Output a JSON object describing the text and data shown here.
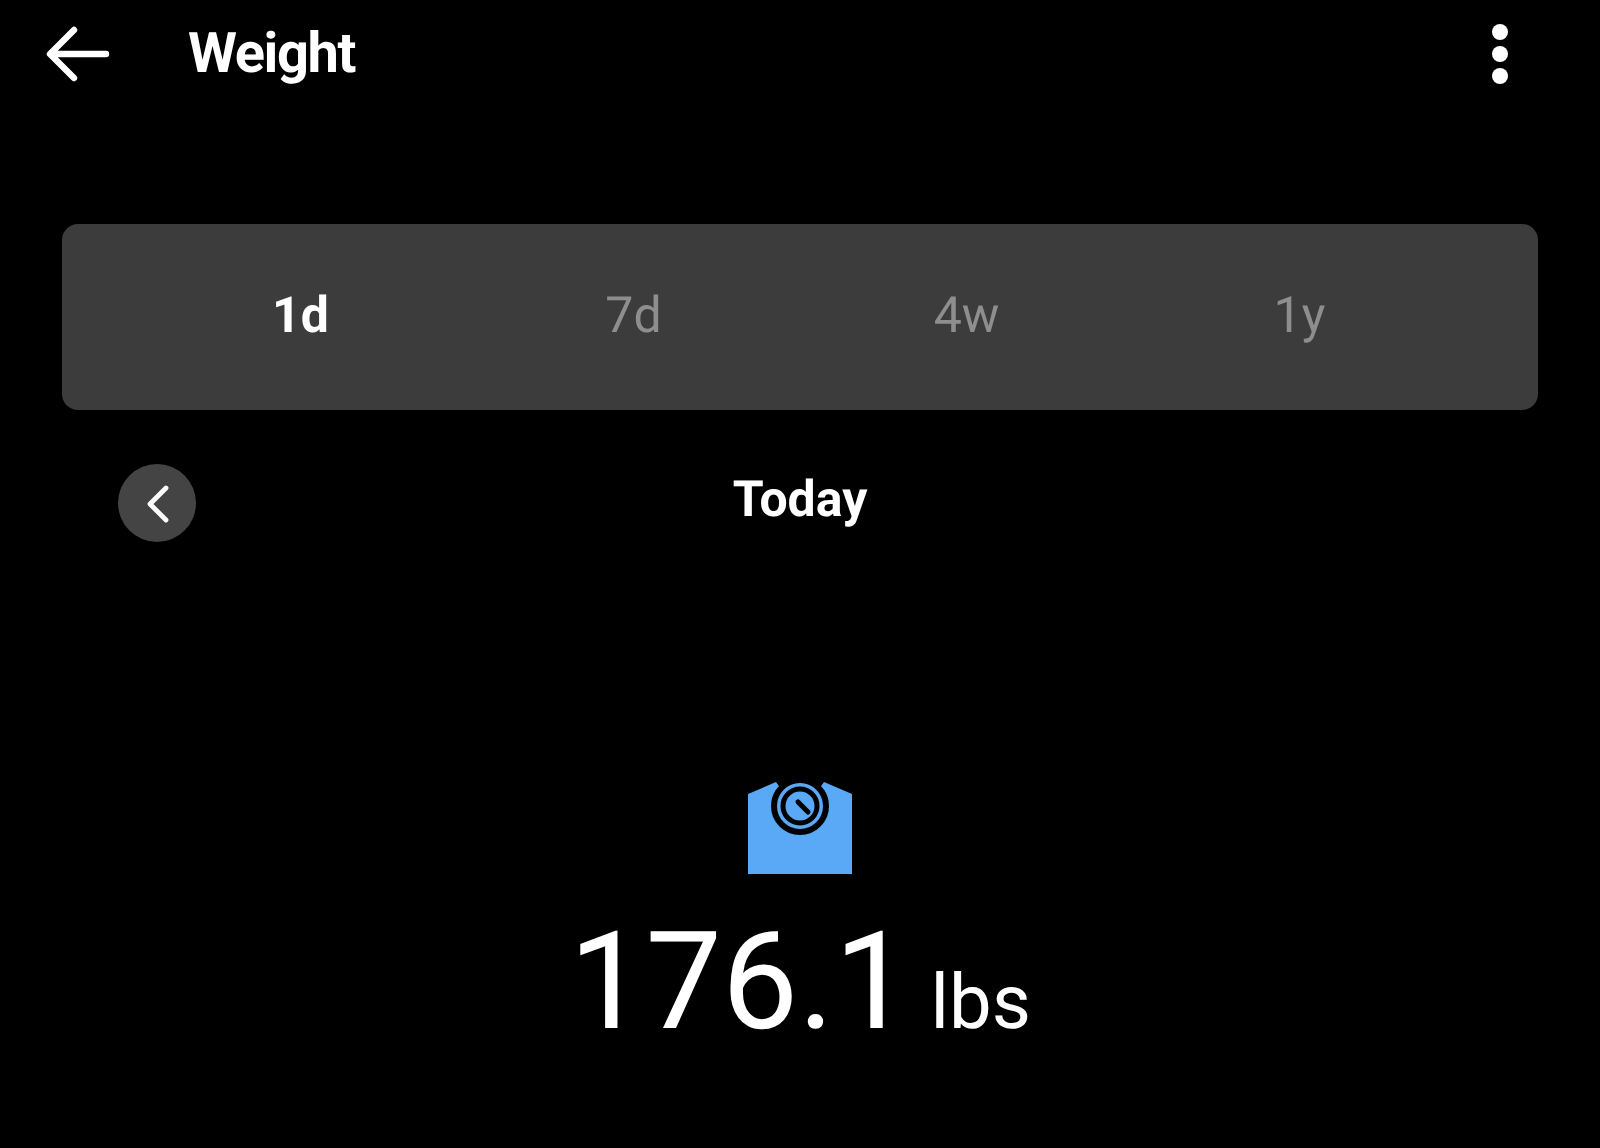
{
  "header": {
    "title": "Weight"
  },
  "tabs": [
    {
      "label": "1d",
      "selected": true
    },
    {
      "label": "7d",
      "selected": false
    },
    {
      "label": "4w",
      "selected": false
    },
    {
      "label": "1y",
      "selected": false
    }
  ],
  "period": {
    "label": "Today"
  },
  "reading": {
    "value": "176.1",
    "unit": "lbs"
  }
}
